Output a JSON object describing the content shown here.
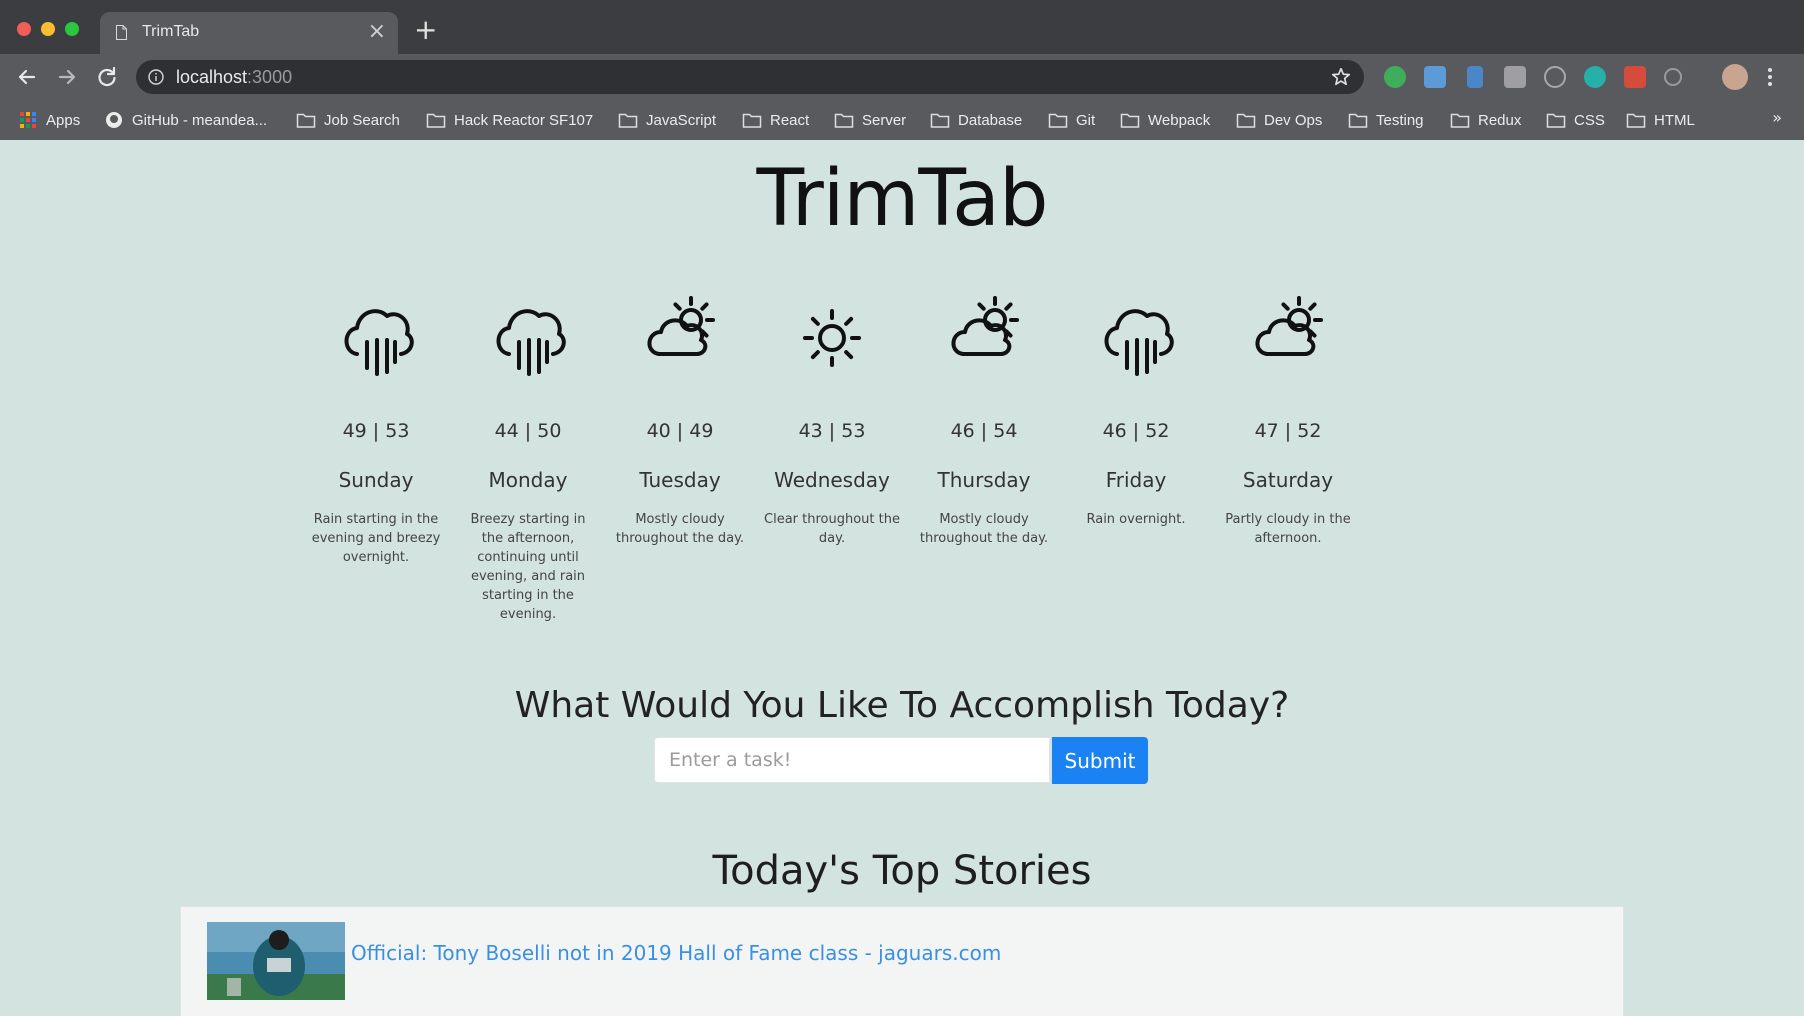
{
  "browser": {
    "tab_title": "TrimTab",
    "tab_close": "×",
    "new_tab": "+",
    "url_host": "localhost",
    "url_port": ":3000",
    "bookmarks": [
      {
        "label": "Apps",
        "icon": "apps-grid-icon"
      },
      {
        "label": "GitHub - meandea...",
        "icon": "github-icon"
      },
      {
        "label": "Job Search",
        "icon": "folder-icon"
      },
      {
        "label": "Hack Reactor SF107",
        "icon": "folder-icon"
      },
      {
        "label": "JavaScript",
        "icon": "folder-icon"
      },
      {
        "label": "React",
        "icon": "folder-icon"
      },
      {
        "label": "Server",
        "icon": "folder-icon"
      },
      {
        "label": "Database",
        "icon": "folder-icon"
      },
      {
        "label": "Git",
        "icon": "folder-icon"
      },
      {
        "label": "Webpack",
        "icon": "folder-icon"
      },
      {
        "label": "Dev Ops",
        "icon": "folder-icon"
      },
      {
        "label": "Testing",
        "icon": "folder-icon"
      },
      {
        "label": "Redux",
        "icon": "folder-icon"
      },
      {
        "label": "CSS",
        "icon": "folder-icon"
      },
      {
        "label": "HTML",
        "icon": "folder-icon"
      }
    ],
    "bookmarks_more": "»"
  },
  "app": {
    "title": "TrimTab",
    "forecast": [
      {
        "icon": "rain-icon",
        "temps": "49 | 53",
        "day": "Sunday",
        "summary": "Rain starting in the evening and breezy overnight."
      },
      {
        "icon": "rain-icon",
        "temps": "44 | 50",
        "day": "Monday",
        "summary": "Breezy starting in the afternoon, continuing until evening, and rain starting in the evening."
      },
      {
        "icon": "partly-cloudy-icon",
        "temps": "40 | 49",
        "day": "Tuesday",
        "summary": "Mostly cloudy throughout the day."
      },
      {
        "icon": "sun-icon",
        "temps": "43 | 53",
        "day": "Wednesday",
        "summary": "Clear throughout the day."
      },
      {
        "icon": "partly-cloudy-icon",
        "temps": "46 | 54",
        "day": "Thursday",
        "summary": "Mostly cloudy throughout the day."
      },
      {
        "icon": "rain-icon",
        "temps": "46 | 52",
        "day": "Friday",
        "summary": "Rain overnight."
      },
      {
        "icon": "partly-cloudy-icon",
        "temps": "47 | 52",
        "day": "Saturday",
        "summary": "Partly cloudy in the afternoon."
      }
    ],
    "task_heading": "What Would You Like To Accomplish Today?",
    "task_placeholder": "Enter a task!",
    "task_value": "",
    "submit_label": "Submit",
    "stories_heading": "Today's Top Stories",
    "stories": [
      {
        "headline": "Official: Tony Boselli not in 2019 Hall of Fame class - jaguars.com"
      }
    ]
  },
  "colors": {
    "page_background": "#d3e4e0",
    "submit_button": "#1a82f2",
    "story_link": "#3b8fe3",
    "chrome_dark": "#3c3d41",
    "chrome_toolbar": "#595a5e"
  }
}
